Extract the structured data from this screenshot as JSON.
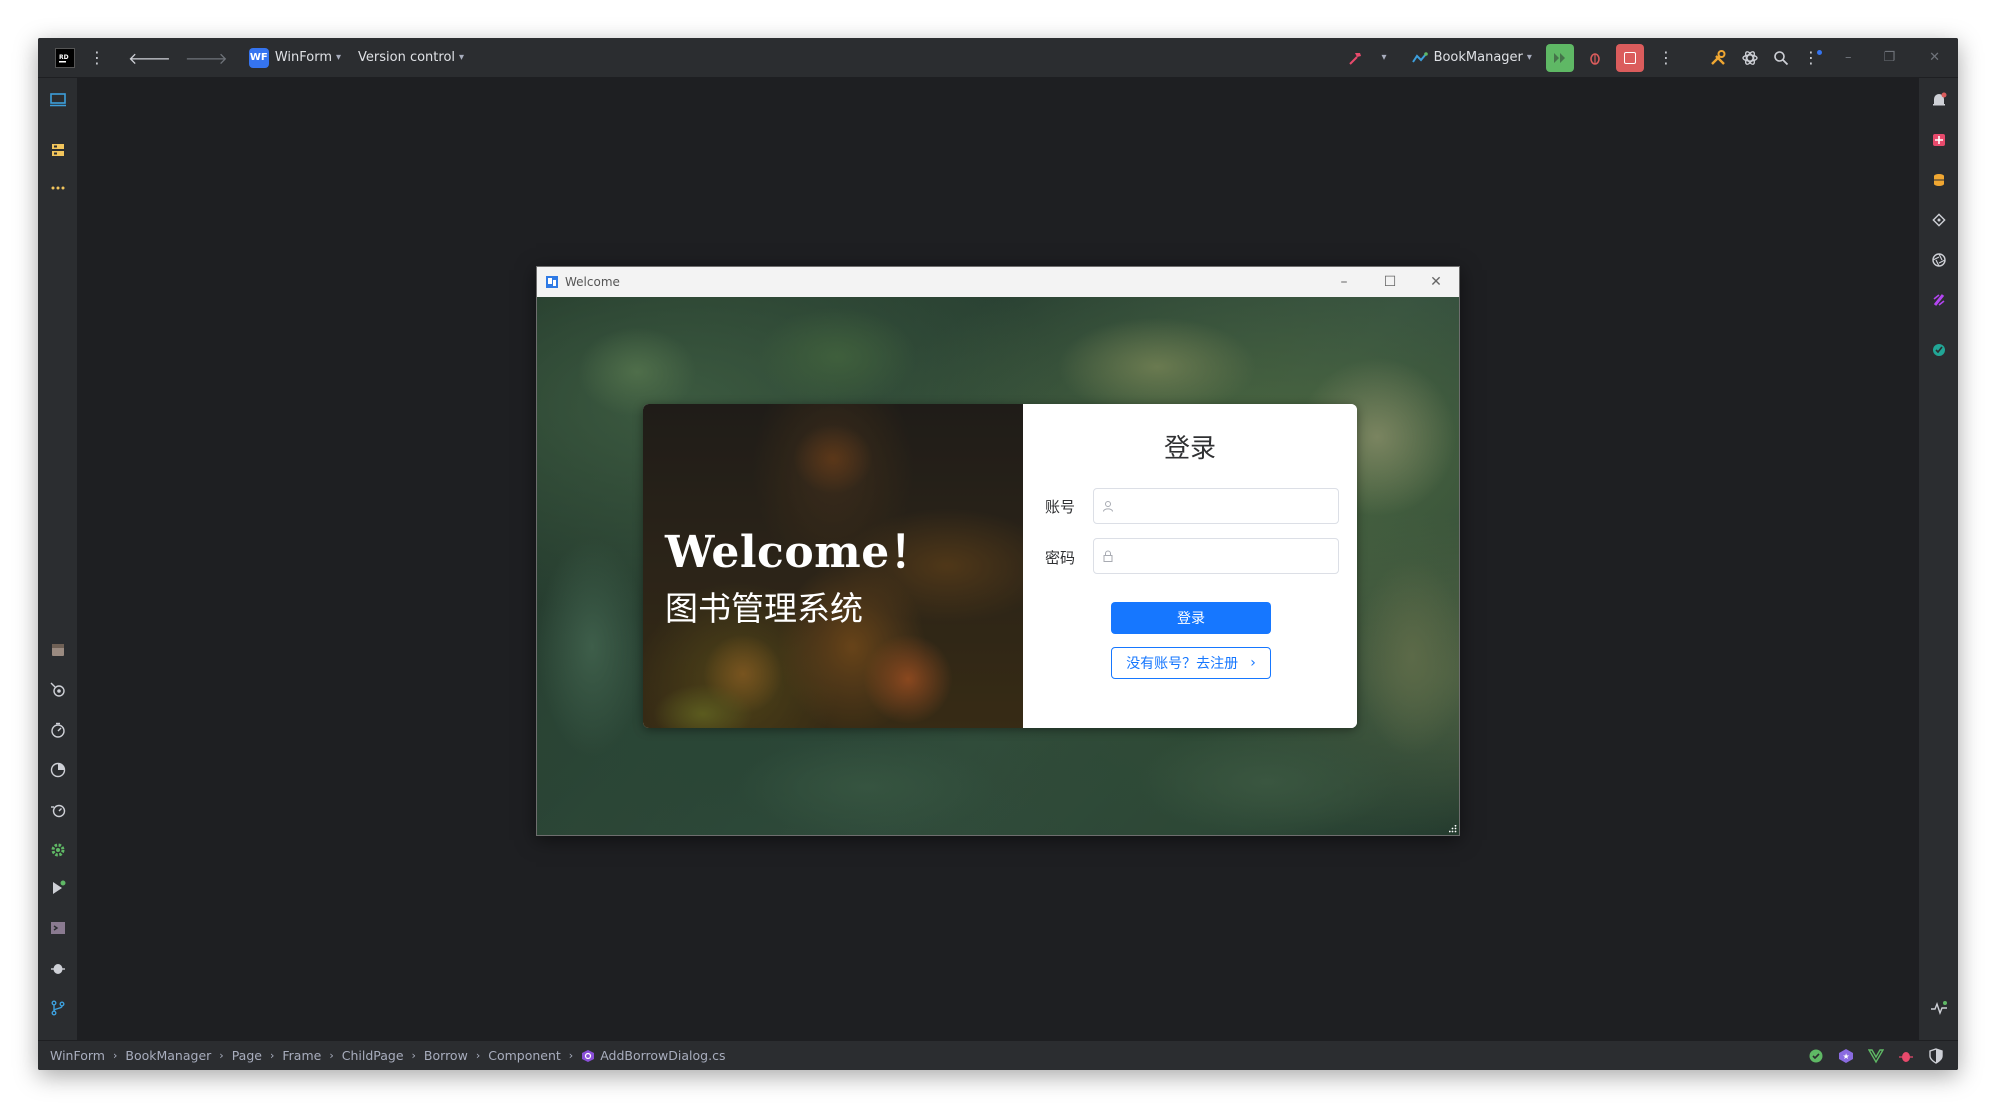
{
  "ide": {
    "project": {
      "badge": "WF",
      "name": "WinForm"
    },
    "vcs_label": "Version control",
    "run_config": "BookManager",
    "colors": {
      "accent_blue": "#3574f0",
      "run_green": "#5fb865",
      "stop_red": "#db5c5c"
    }
  },
  "breadcrumb": [
    "WinForm",
    "BookManager",
    "Page",
    "Frame",
    "ChildPage",
    "Borrow",
    "Component",
    "AddBorrowDialog.cs"
  ],
  "winform": {
    "title": "Welcome",
    "hero_title": "Welcome！",
    "hero_subtitle": "图书管理系统",
    "login": {
      "title": "登录",
      "account_label": "账号",
      "account_value": "",
      "password_label": "密码",
      "password_value": "",
      "login_button": "登录",
      "register_button": "没有账号？去注册"
    },
    "colors": {
      "primary": "#1677ff"
    }
  }
}
